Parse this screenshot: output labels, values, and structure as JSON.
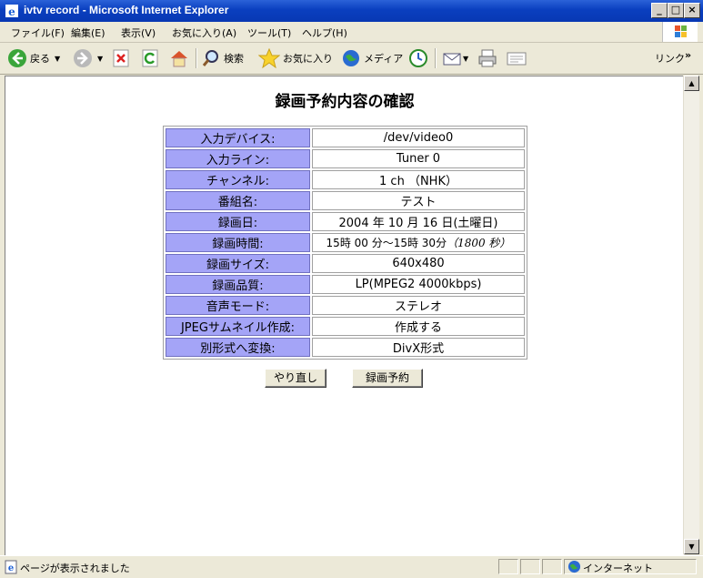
{
  "window": {
    "title": "ivtv record - Microsoft Internet Explorer"
  },
  "menu": [
    "ファイル(F)",
    "編集(E)",
    "表示(V)",
    "お気に入り(A)",
    "ツール(T)",
    "ヘルプ(H)"
  ],
  "toolbar": {
    "back": "戻る",
    "search": "検索",
    "favorites": "お気に入り",
    "media": "メディア",
    "links": "リンク"
  },
  "page": {
    "heading": "録画予約内容の確認",
    "rows": [
      {
        "label": "入力デバイス:",
        "value": "/dev/video0"
      },
      {
        "label": "入力ライン:",
        "value": "Tuner 0"
      },
      {
        "label": "チャンネル:",
        "value": "1 ch （NHK）"
      },
      {
        "label": "番組名:",
        "value": "テスト"
      },
      {
        "label": "録画日:",
        "value": "2004 年 10 月 16 日(土曜日)"
      },
      {
        "label": "録画時間:",
        "value": "15時 00 分～15時 30分",
        "note": "（1800 秒）"
      },
      {
        "label": "録画サイズ:",
        "value": "640x480"
      },
      {
        "label": "録画品質:",
        "value": "LP(MPEG2 4000kbps)"
      },
      {
        "label": "音声モード:",
        "value": "ステレオ"
      },
      {
        "label": "JPEGサムネイル作成:",
        "value": "作成する"
      },
      {
        "label": "別形式へ変換:",
        "value": "DivX形式"
      }
    ],
    "buttons": {
      "redo": "やり直し",
      "reserve": "録画予約"
    }
  },
  "status": {
    "text": "ページが表示されました",
    "zone": "インターネット"
  },
  "colors": {
    "label_bg": "#a4a4f7",
    "titlebar": "#0a3fbf"
  }
}
